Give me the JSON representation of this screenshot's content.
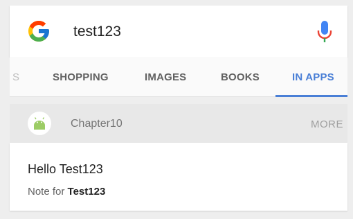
{
  "search": {
    "query": "test123",
    "logo_icon": "google-g-icon",
    "mic_icon": "microphone-icon"
  },
  "tabs": [
    {
      "label": "S",
      "partial": true
    },
    {
      "label": "SHOPPING"
    },
    {
      "label": "IMAGES"
    },
    {
      "label": "BOOKS"
    },
    {
      "label": "IN APPS",
      "active": true
    }
  ],
  "app": {
    "name": "Chapter10",
    "icon": "android-icon",
    "more_label": "MORE"
  },
  "result": {
    "title": "Hello Test123",
    "subtitle_prefix": "Note for ",
    "subtitle_bold": "Test123"
  },
  "colors": {
    "accent": "#4a7fd6",
    "android_green": "#9ccc65"
  }
}
